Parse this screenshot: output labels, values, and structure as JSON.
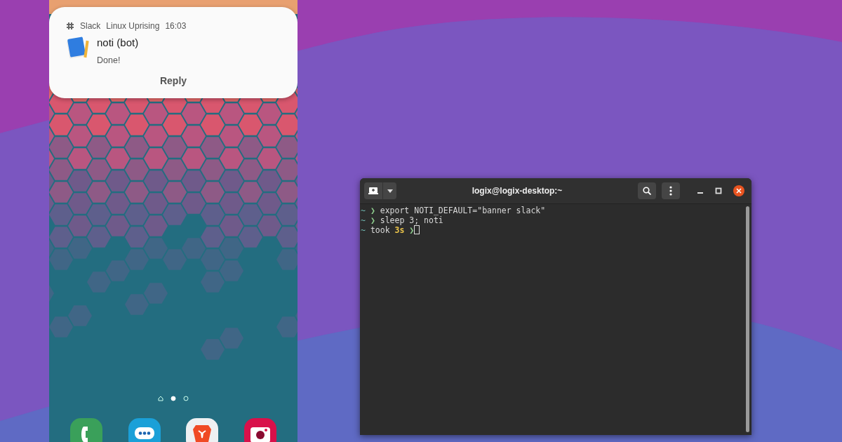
{
  "notification": {
    "app": "Slack",
    "account": "Linux Uprising",
    "time": "16:03",
    "title": "noti (bot)",
    "message": "Done!",
    "action": "Reply"
  },
  "page_dots": [
    {
      "kind": "home",
      "selected": false
    },
    {
      "kind": "dot",
      "selected": true
    },
    {
      "kind": "dot",
      "selected": false
    }
  ],
  "dock": [
    {
      "kind": "phone"
    },
    {
      "kind": "messages"
    },
    {
      "kind": "browser"
    },
    {
      "kind": "camera"
    }
  ],
  "terminal": {
    "title": "logix@logix-desktop:~",
    "lines": [
      {
        "kind": "command",
        "dir": "~",
        "arrow": "❯",
        "text": "export NOTI_DEFAULT=\"banner slack\""
      },
      {
        "kind": "command",
        "dir": "~",
        "arrow": "❯",
        "text": "sleep 3; noti"
      },
      {
        "kind": "status",
        "dir": "~",
        "label": "took",
        "duration": "3s",
        "arrow": "❯",
        "cursor": true
      }
    ]
  }
}
